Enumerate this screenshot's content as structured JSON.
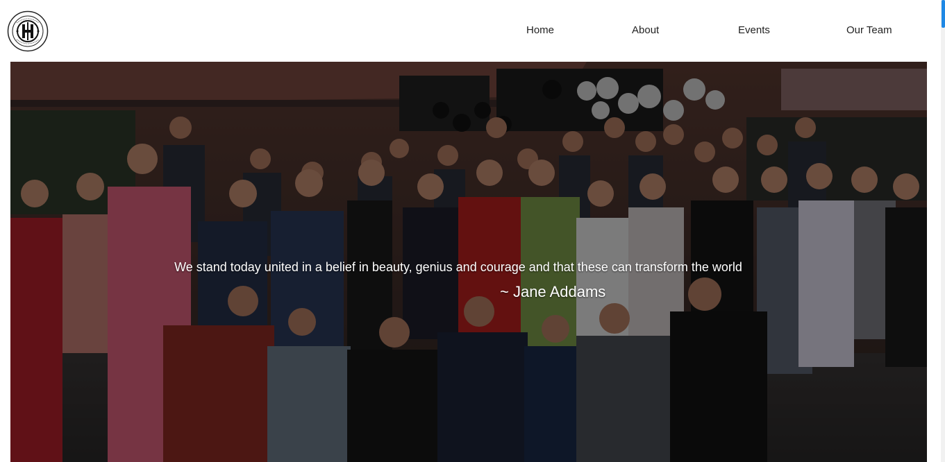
{
  "nav": {
    "logo_name": "university-seal-logo",
    "links": [
      {
        "label": "Home"
      },
      {
        "label": "About"
      },
      {
        "label": "Events"
      },
      {
        "label": "Our Team"
      }
    ]
  },
  "hero": {
    "quote": "We stand today united in a belief in beauty, genius and courage and that these can transform the world",
    "author": "~ Jane Addams"
  },
  "colors": {
    "nav_bg": "#ffffff",
    "nav_text": "#222222",
    "hero_text": "#ffffff",
    "scroll_thumb": "#1e88e5"
  }
}
